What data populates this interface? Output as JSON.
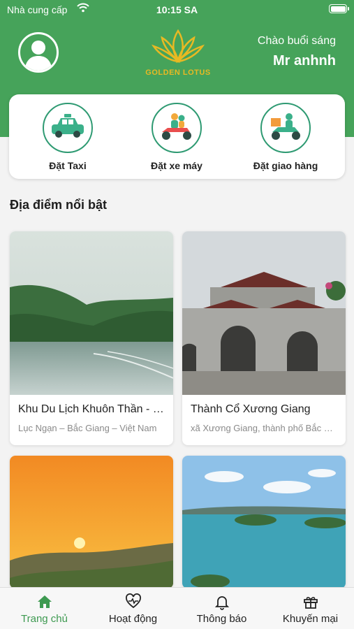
{
  "status_bar": {
    "carrier": "Nhà cung cấp",
    "time": "10:15 SA"
  },
  "header": {
    "logo_text": "GOLDEN LOTUS",
    "greeting": "Chào buổi sáng",
    "username": "Mr anhnh",
    "brand_color": "#46a35a",
    "logo_color": "#e8b923"
  },
  "services": [
    {
      "label": "Đặt Taxi",
      "icon": "taxi-icon"
    },
    {
      "label": "Đặt xe máy",
      "icon": "motorbike-icon"
    },
    {
      "label": "Đặt giao hàng",
      "icon": "delivery-icon"
    }
  ],
  "featured": {
    "title": "Địa điểm nổi bật",
    "places": [
      {
        "name": "Khu Du Lịch Khuôn Thần - Lục Ngạn",
        "address": "Lục Ngạn – Bắc Giang – Việt Nam",
        "image": "lake-forest-photo"
      },
      {
        "name": "Thành Cổ Xương Giang",
        "address": "xã Xương Giang, thành phố Bắc Giang",
        "image": "ancient-gate-photo"
      },
      {
        "name": "",
        "address": "",
        "image": "sunset-hills-photo"
      },
      {
        "name": "",
        "address": "",
        "image": "lake-islands-photo"
      }
    ]
  },
  "tabbar": {
    "active_color": "#3e9a51",
    "tabs": [
      {
        "label": "Trang chủ",
        "icon": "home-icon",
        "active": true
      },
      {
        "label": "Hoạt động",
        "icon": "heart-pulse-icon",
        "active": false
      },
      {
        "label": "Thông báo",
        "icon": "bell-icon",
        "active": false
      },
      {
        "label": "Khuyến mại",
        "icon": "gift-icon",
        "active": false
      }
    ]
  }
}
